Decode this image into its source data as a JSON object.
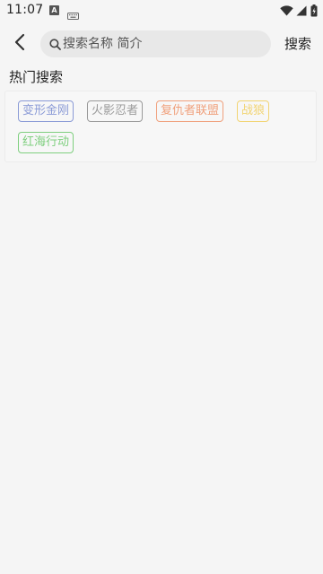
{
  "status_bar": {
    "time": "11:07",
    "a_badge": "A",
    "icons": [
      "notification-a-icon",
      "keyboard-icon",
      "wifi-icon",
      "signal-icon",
      "battery-icon"
    ]
  },
  "header": {
    "back_icon": "chevron-left-icon",
    "search_placeholder": "搜索名称 简介",
    "search_value": "",
    "search_button_label": "搜索"
  },
  "hot_search": {
    "title": "热门搜索",
    "tags": [
      {
        "label": "变形金刚",
        "color": "#8a9ad6"
      },
      {
        "label": "火影忍者",
        "color": "#9a9a9a"
      },
      {
        "label": "复仇者联盟",
        "color": "#f0a07c"
      },
      {
        "label": "战狼",
        "color": "#f2d472"
      },
      {
        "label": "红海行动",
        "color": "#7fcf7f"
      }
    ]
  },
  "colors": {
    "background": "#f5f5f5",
    "search_box": "#e8e8e8"
  }
}
